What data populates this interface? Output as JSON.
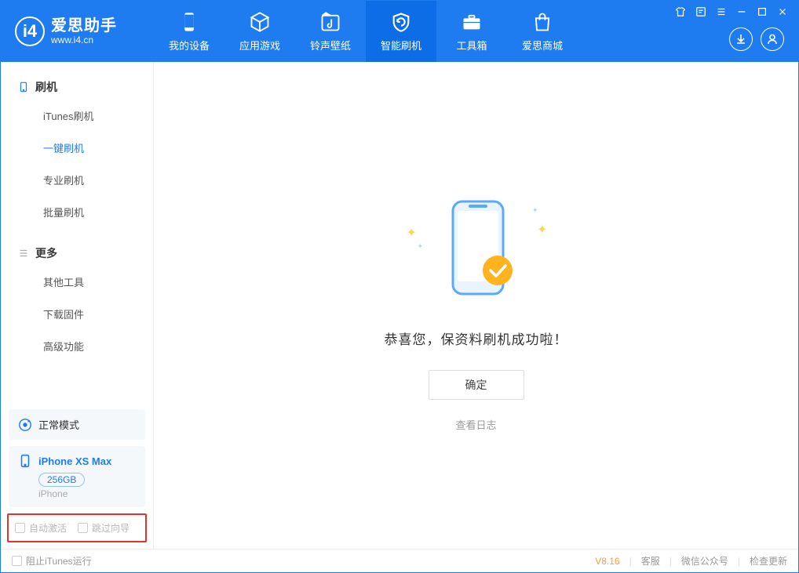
{
  "logo": {
    "cn": "爱思助手",
    "en": "www.i4.cn"
  },
  "tabs": [
    {
      "label": "我的设备"
    },
    {
      "label": "应用游戏"
    },
    {
      "label": "铃声壁纸"
    },
    {
      "label": "智能刷机"
    },
    {
      "label": "工具箱"
    },
    {
      "label": "爱思商城"
    }
  ],
  "sidebar": {
    "section1": {
      "title": "刷机",
      "items": [
        "iTunes刷机",
        "一键刷机",
        "专业刷机",
        "批量刷机"
      ]
    },
    "section2": {
      "title": "更多",
      "items": [
        "其他工具",
        "下载固件",
        "高级功能"
      ]
    },
    "mode": "正常模式",
    "device": {
      "name": "iPhone XS Max",
      "capacity": "256GB",
      "type": "iPhone"
    },
    "opt1": "自动激活",
    "opt2": "跳过向导"
  },
  "main": {
    "success_msg": "恭喜您，保资料刷机成功啦！",
    "ok": "确定",
    "view_logs": "查看日志"
  },
  "footer": {
    "block_itunes": "阻止iTunes运行",
    "version": "V8.16",
    "support": "客服",
    "wechat": "微信公众号",
    "update": "检查更新"
  }
}
